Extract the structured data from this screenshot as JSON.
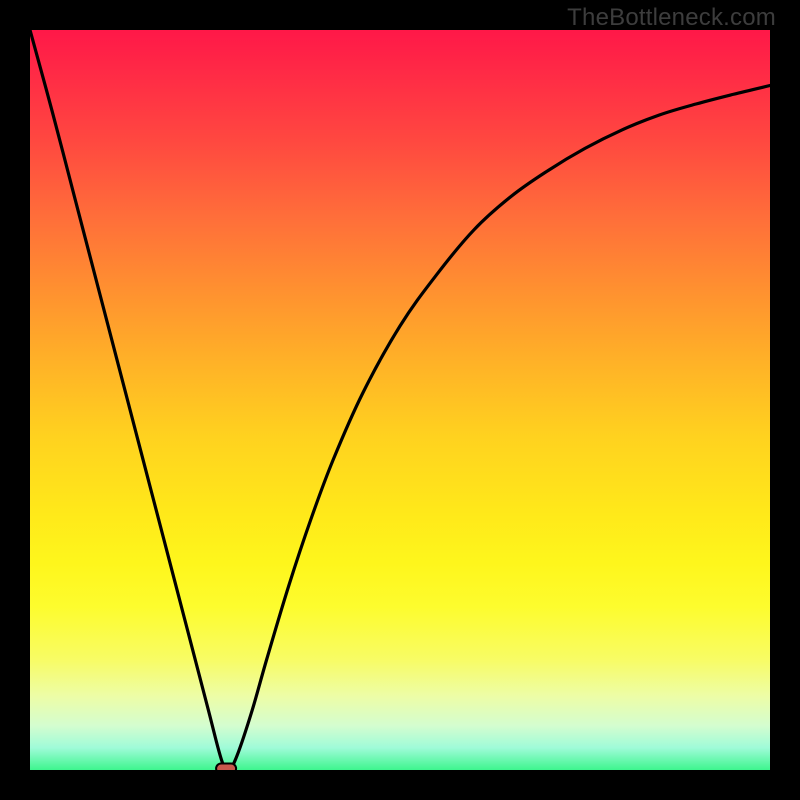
{
  "watermark": {
    "text": "TheBottleneck.com"
  },
  "chart_data": {
    "type": "line",
    "title": "",
    "xlabel": "",
    "ylabel": "",
    "xlim": [
      0,
      100
    ],
    "ylim": [
      0,
      100
    ],
    "grid": false,
    "series": [
      {
        "name": "bottleneck-curve",
        "x": [
          0,
          3,
          6,
          9,
          12,
          15,
          18,
          21,
          24,
          26,
          27,
          28,
          30,
          32,
          35,
          38,
          41,
          45,
          50,
          55,
          60,
          65,
          70,
          75,
          80,
          85,
          90,
          95,
          100
        ],
        "values": [
          100,
          89,
          77.5,
          66,
          54.5,
          43,
          31.5,
          20,
          8.5,
          1,
          0.3,
          2,
          8,
          15,
          25,
          34,
          42,
          51,
          60,
          67,
          73,
          77.5,
          81,
          84,
          86.5,
          88.5,
          90,
          91.3,
          92.5
        ]
      }
    ],
    "marker": {
      "x": 26.5,
      "y": 0.2,
      "shape": "rounded-rect"
    }
  }
}
